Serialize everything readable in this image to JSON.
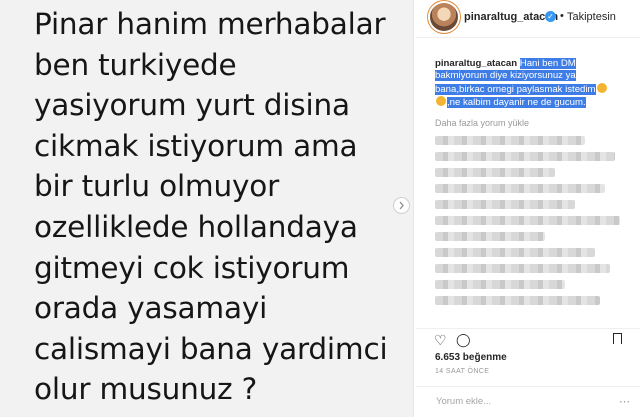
{
  "image": {
    "lines": [
      "Pinar hanim merhabalar",
      "ben turkiyede",
      "yasiyorum yurt disina",
      "cikmak istiyorum ama",
      "bir turlu olmuyor",
      "ozelliklede hollandaya",
      "gitmeyi cok istiyorum",
      "orada yasamayi",
      "calismayi bana yardimci",
      "olur musunuz ?"
    ]
  },
  "header": {
    "username": "pinaraltug_atacan",
    "dot": "•",
    "follow_label": "Takiptesin"
  },
  "caption": {
    "username": "pinaraltug_atacan",
    "line1": "Hani ben DM",
    "line2": "bakmiyorum diye kiziyorsunuz ya",
    "line3": "bana,birkac ornegi paylasmak istedim",
    "line4": ",ne kalbim dayanir ne de gucum."
  },
  "comments": {
    "load_more": "Daha fazla yorum yükle"
  },
  "likes": "6.653 beğenme",
  "time": "14 SAAT ÖNCE",
  "comment_input": {
    "placeholder": "Yorum ekle..."
  },
  "colors": {
    "highlight": "#3f7de6",
    "verified": "#3897f0"
  }
}
